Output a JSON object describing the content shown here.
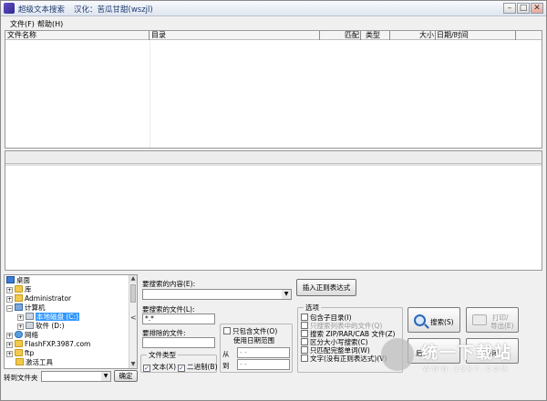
{
  "window": {
    "title": "超级文本搜索",
    "credit": "汉化：苦瓜甘甜(wszjl)",
    "controls": {
      "minimize": "–",
      "maximize": "□",
      "close": "✕"
    }
  },
  "menu": [
    "文件(F)",
    "帮助(H)"
  ],
  "results": {
    "columns": [
      "文件名称",
      "目录",
      "匹配",
      "类型",
      "大小",
      "日期/时间"
    ]
  },
  "tree": {
    "items": [
      {
        "label": "桌面",
        "icon": "desktop-icon"
      },
      {
        "label": "库",
        "icon": "folder-icon"
      },
      {
        "label": "Administrator",
        "icon": "user-folder-icon"
      },
      {
        "label": "计算机",
        "icon": "computer-icon"
      },
      {
        "label": "本地磁盘 (C:)",
        "icon": "drive-icon",
        "selected": true
      },
      {
        "label": "软件 (D:)",
        "icon": "drive-icon"
      },
      {
        "label": "网络",
        "icon": "network-icon"
      },
      {
        "label": "FlashFXP.3987.com",
        "icon": "folder-icon"
      },
      {
        "label": "ftp",
        "icon": "folder-icon"
      },
      {
        "label": "激活工具",
        "icon": "folder-icon"
      }
    ]
  },
  "goto": {
    "label": "转到文件夹",
    "button": "确定"
  },
  "mid_arrow": "<",
  "search": {
    "content_label": "要搜索的内容(E):",
    "content_value": "",
    "insert_regex_button": "插入正则表达式",
    "files_label": "要搜索的文件(L):",
    "files_value": "*.*",
    "exclude_label": "要排除的文件:",
    "exclude_value": "",
    "file_type_title": "文件类型",
    "text_checkbox": "文本(X)",
    "binary_checkbox": "二进制(B)",
    "date_checkbox": "只包含文件(O)",
    "date_checkbox_line2": "使用日期范围",
    "from_label": "从",
    "to_label": "到",
    "from_value": "-  -",
    "to_value": "-  -"
  },
  "options": {
    "title": "选项",
    "items": [
      {
        "label": "包含子目录(I)",
        "checked": false,
        "disabled": false
      },
      {
        "label": "只搜索列表中的文件(Q)",
        "checked": false,
        "disabled": true
      },
      {
        "label": "搜索 ZIP/RAR/CAB 文件(Z)",
        "checked": false,
        "disabled": false
      },
      {
        "label": "区分大小写搜索(C)",
        "checked": false,
        "disabled": false
      },
      {
        "label": "只匹配完整单词(W)",
        "checked": false,
        "disabled": false
      },
      {
        "label": "文字(没有正则表达式)(V)",
        "checked": false,
        "disabled": false
      }
    ]
  },
  "actions": {
    "search_button": "搜索(S)",
    "print_button_line1": "打印/",
    "print_button_line2": "导出(E)",
    "back_button": "后(",
    "close_button": "关闭"
  },
  "watermark": {
    "text": "统一下载站",
    "sub": "WWW.3987.COM"
  }
}
